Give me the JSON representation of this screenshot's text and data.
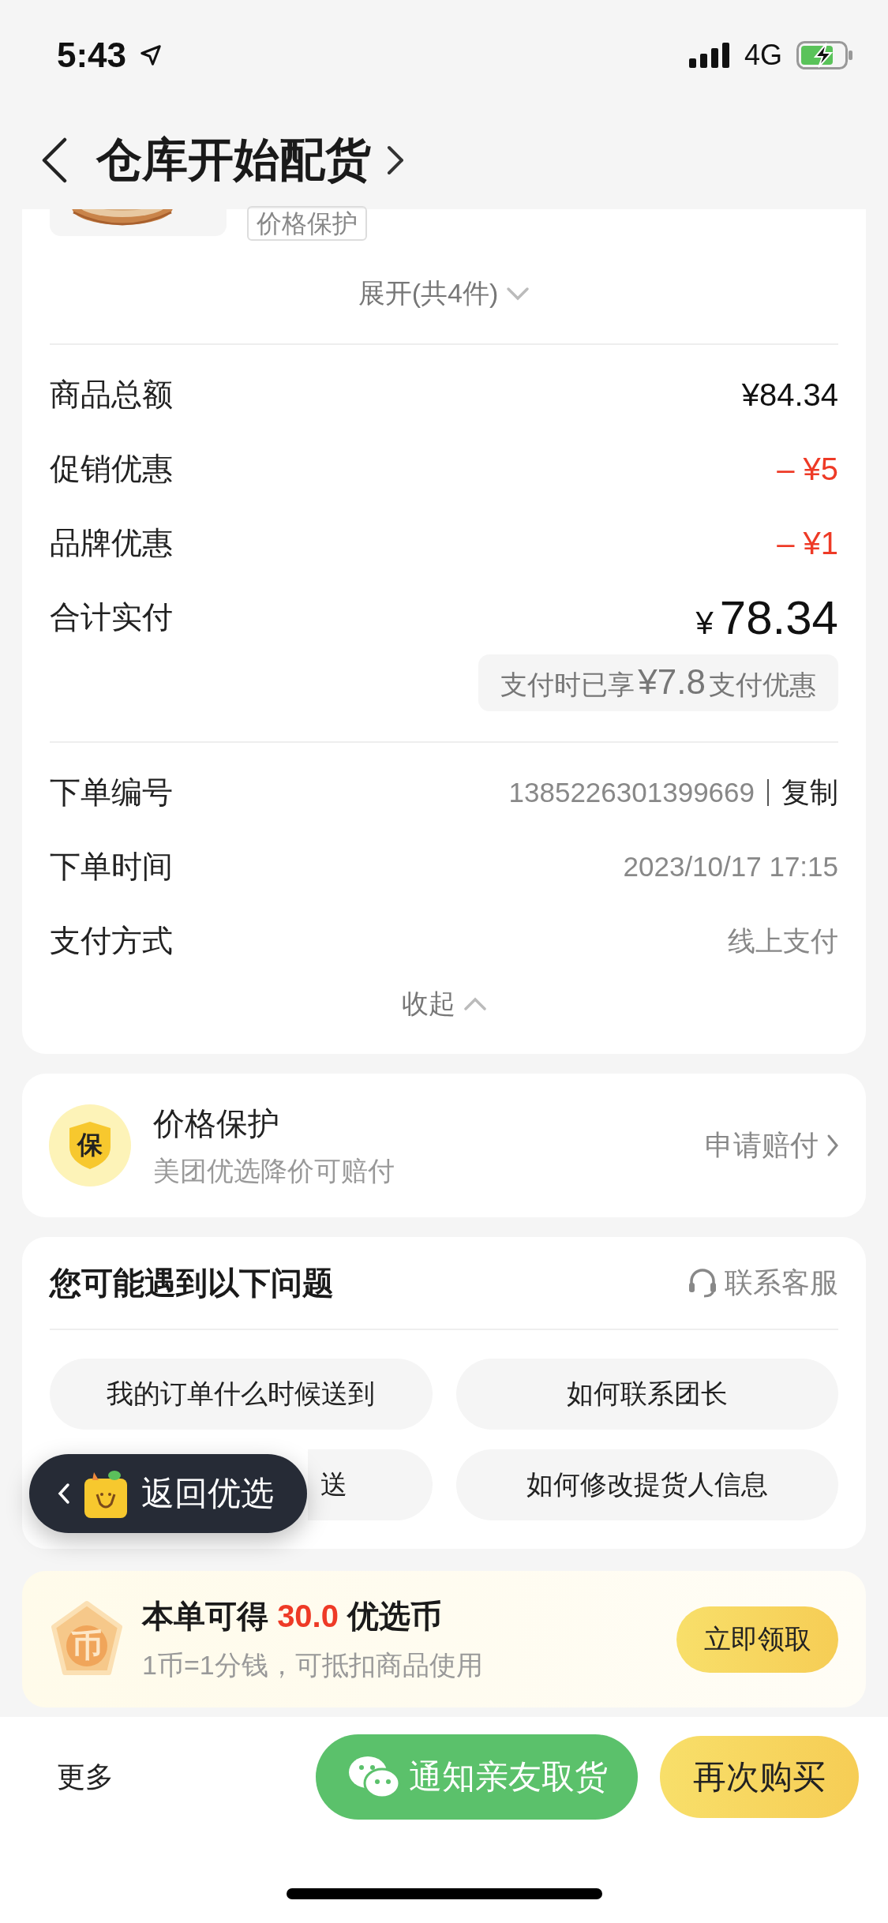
{
  "status_bar": {
    "time": "5:43",
    "network": "4G"
  },
  "header": {
    "title": "仓库开始配货"
  },
  "order_card": {
    "product_tag": "价格保护",
    "expand": "展开(共4件)",
    "amounts": [
      {
        "label": "商品总额",
        "value": "¥84.34",
        "kind": "normal"
      },
      {
        "label": "促销优惠",
        "value": "– ¥5",
        "kind": "discount"
      },
      {
        "label": "品牌优惠",
        "value": "– ¥1",
        "kind": "discount"
      }
    ],
    "total": {
      "label": "合计实付",
      "currency": "¥",
      "value": "78.34"
    },
    "payment_discount": {
      "prefix": "支付时已享",
      "amount": "¥7.8",
      "suffix": "支付优惠"
    },
    "details": [
      {
        "label": "下单编号",
        "value": "1385226301399669",
        "action": "复制"
      },
      {
        "label": "下单时间",
        "value": "2023/10/17 17:15"
      },
      {
        "label": "支付方式",
        "value": "线上支付"
      }
    ],
    "collapse": "收起"
  },
  "price_protection": {
    "badge": "保",
    "title": "价格保护",
    "subtitle": "美团优选降价可赔付",
    "action": "申请赔付"
  },
  "questions": {
    "title": "您可能遇到以下问题",
    "contact": "联系客服",
    "items": [
      "我的订单什么时候送到",
      "如何联系团长",
      "送",
      "如何修改提货人信息"
    ]
  },
  "floating_back": {
    "label": "返回优选"
  },
  "coins": {
    "icon_text": "币",
    "prefix": "本单可得",
    "amount": "30.0",
    "suffix": "优选币",
    "note": "1币=1分钱，可抵扣商品使用",
    "button": "立即领取"
  },
  "bottom_bar": {
    "more": "更多",
    "notify": "通知亲友取货",
    "rebuy": "再次购买"
  }
}
